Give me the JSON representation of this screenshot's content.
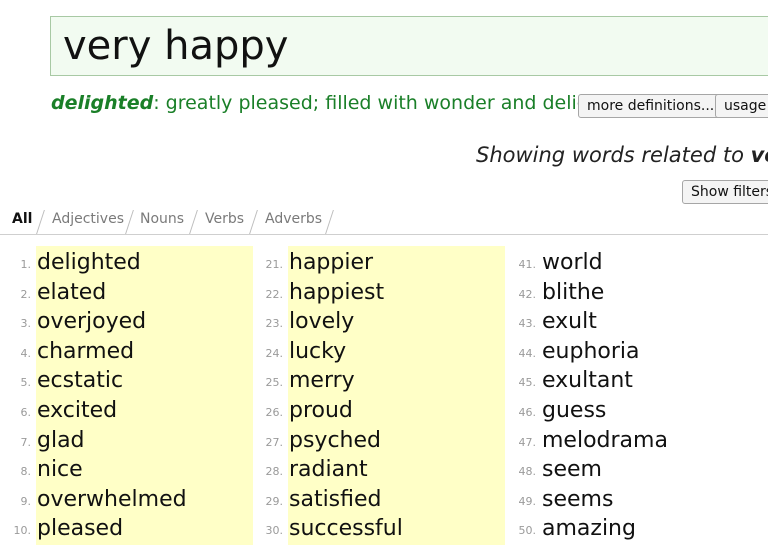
{
  "search": {
    "query": "very happy"
  },
  "definition": {
    "word": "delighted",
    "text": ": greatly pleased; filled with wonder and delight;",
    "more_button": "more definitions...",
    "usage_button": "usage"
  },
  "showing": {
    "prefix": "Showing words related to ",
    "bold": "ver"
  },
  "filters_button": "Show filters",
  "tabs": [
    "All",
    "Adjectives",
    "Nouns",
    "Verbs",
    "Adverbs"
  ],
  "colors": {
    "accent_green": "#1a7f28",
    "highlight_yellow": "#ffffc7",
    "search_bg": "#f2fbf1"
  },
  "results": [
    {
      "num": "1.",
      "word": "delighted"
    },
    {
      "num": "2.",
      "word": "elated"
    },
    {
      "num": "3.",
      "word": "overjoyed"
    },
    {
      "num": "4.",
      "word": "charmed"
    },
    {
      "num": "5.",
      "word": "ecstatic"
    },
    {
      "num": "6.",
      "word": "excited"
    },
    {
      "num": "7.",
      "word": "glad"
    },
    {
      "num": "8.",
      "word": "nice"
    },
    {
      "num": "9.",
      "word": "overwhelmed"
    },
    {
      "num": "10.",
      "word": "pleased"
    },
    {
      "num": "21.",
      "word": "happier"
    },
    {
      "num": "22.",
      "word": "happiest"
    },
    {
      "num": "23.",
      "word": "lovely"
    },
    {
      "num": "24.",
      "word": "lucky"
    },
    {
      "num": "25.",
      "word": "merry"
    },
    {
      "num": "26.",
      "word": "proud"
    },
    {
      "num": "27.",
      "word": "psyched"
    },
    {
      "num": "28.",
      "word": "radiant"
    },
    {
      "num": "29.",
      "word": "satisfied"
    },
    {
      "num": "30.",
      "word": "successful"
    },
    {
      "num": "41.",
      "word": "world"
    },
    {
      "num": "42.",
      "word": "blithe"
    },
    {
      "num": "43.",
      "word": "exult"
    },
    {
      "num": "44.",
      "word": "euphoria"
    },
    {
      "num": "45.",
      "word": "exultant"
    },
    {
      "num": "46.",
      "word": "guess"
    },
    {
      "num": "47.",
      "word": "melodrama"
    },
    {
      "num": "48.",
      "word": "seem"
    },
    {
      "num": "49.",
      "word": "seems"
    },
    {
      "num": "50.",
      "word": "amazing"
    }
  ]
}
